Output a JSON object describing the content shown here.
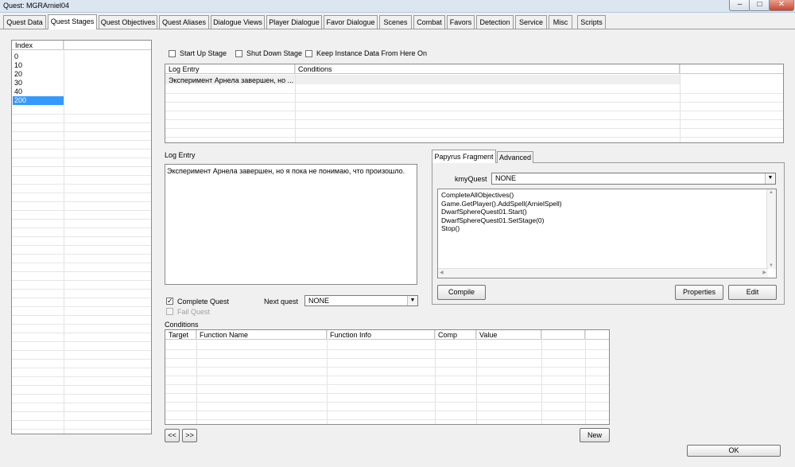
{
  "window": {
    "title": "Quest: MGRArniel04"
  },
  "tabs": [
    "Quest Data",
    "Quest Stages",
    "Quest Objectives",
    "Quest Aliases",
    "Dialogue Views",
    "Player Dialogue",
    "Favor Dialogue",
    "Scenes",
    "Combat",
    "Favors",
    "Detection",
    "Service",
    "Misc",
    "Scripts"
  ],
  "index_list": {
    "header": "Index",
    "items": [
      "0",
      "10",
      "20",
      "30",
      "40",
      "200"
    ],
    "selected": "200"
  },
  "stage_flags": {
    "start_up_stage": "Start Up Stage",
    "shut_down_stage": "Shut Down Stage",
    "keep_instance": "Keep Instance Data From Here On"
  },
  "log_table": {
    "columns": [
      "Log Entry",
      "Conditions"
    ],
    "rows": [
      {
        "log_entry": "Эксперимент Арнела завершен, но ...",
        "conditions": ""
      }
    ]
  },
  "log_entry": {
    "label": "Log Entry",
    "text": "Эксперимент Арнела завершен, но я пока не понимаю, что произошло."
  },
  "complete_quest": {
    "label": "Complete Quest",
    "checked": true
  },
  "fail_quest": {
    "label": "Fail Quest",
    "checked": false
  },
  "next_quest": {
    "label": "Next quest",
    "value": "NONE"
  },
  "script_tabs": [
    "Papyrus Fragment",
    "Advanced"
  ],
  "kmy_quest": {
    "label": "kmyQuest",
    "value": "NONE"
  },
  "fragment_code": [
    "CompleteAllObjectives()",
    "Game.GetPlayer().AddSpell(ArnielSpell)",
    "DwarfSphereQuest01.Start()",
    "DwarfSphereQuest01.SetStage(0)",
    "Stop()"
  ],
  "buttons": {
    "compile": "Compile",
    "properties": "Properties",
    "edit": "Edit",
    "prev": "<<",
    "next": ">>",
    "new": "New",
    "ok": "OK"
  },
  "conditions": {
    "label": "Conditions",
    "columns": [
      "Target",
      "Function Name",
      "Function Info",
      "Comp",
      "Value"
    ]
  }
}
